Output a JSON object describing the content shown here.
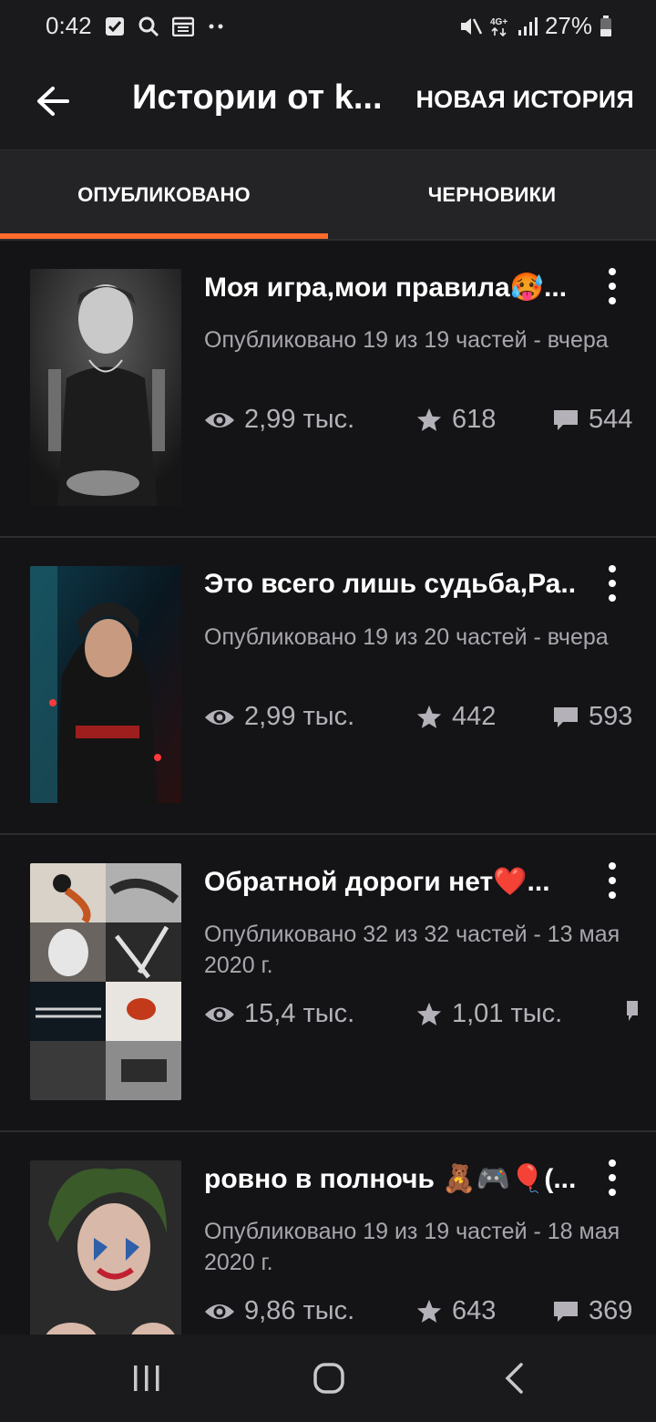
{
  "status": {
    "time": "0:42",
    "battery": "27%",
    "icons_left": [
      "checkbox-icon",
      "search-icon",
      "calendar-icon",
      "more-dots-icon"
    ],
    "icons_right": [
      "mute-icon",
      "4g-icon",
      "signal-icon",
      "battery-icon"
    ]
  },
  "appbar": {
    "title": "Истории от k...",
    "new_story": "НОВАЯ ИСТОРИЯ"
  },
  "tabs": [
    {
      "label": "ОПУБЛИКОВАНО",
      "active": true
    },
    {
      "label": "ЧЕРНОВИКИ",
      "active": false
    }
  ],
  "accent": "#ff6b2b",
  "stories": [
    {
      "title": "Моя игра,мои правила🥵...",
      "meta": "Опубликовано 19 из 19 частей - вчера",
      "views": "2,99 тыс.",
      "votes": "618",
      "comments": "544"
    },
    {
      "title": "Это всего лишь судьба,Ра...",
      "meta": "Опубликовано 19 из 20 частей - вчера",
      "views": "2,99 тыс.",
      "votes": "442",
      "comments": "593"
    },
    {
      "title": "Обратной дороги нет❤️...",
      "meta": "Опубликовано 32 из 32 частей - 13 мая 2020 г.",
      "views": "15,4 тыс.",
      "votes": "1,01 тыс.",
      "comments": ""
    },
    {
      "title": "ровно в полночь 🧸🎮🎈(...",
      "meta": "Опубликовано 19 из 19 частей - 18 мая 2020 г.",
      "views": "9,86 тыс.",
      "votes": "643",
      "comments": "369"
    }
  ]
}
